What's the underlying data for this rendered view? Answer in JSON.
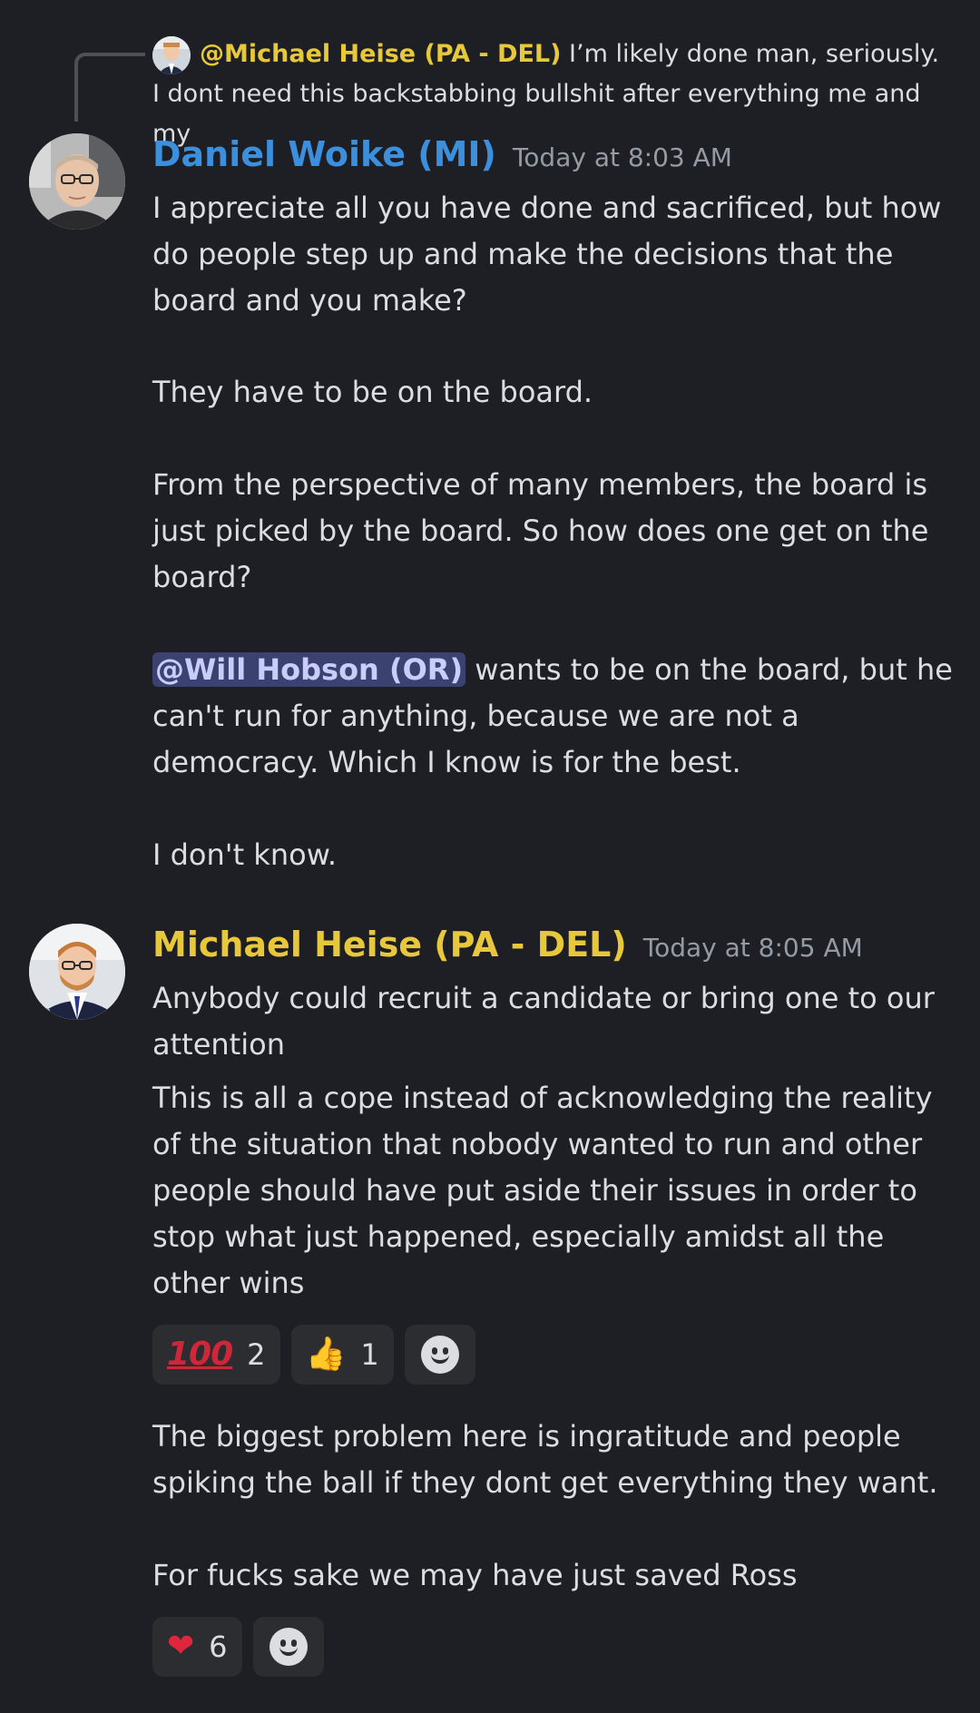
{
  "reply": {
    "author": "@Michael Heise (PA - DEL)",
    "text": "I’m likely done man, seriously. I dont need this backstabbing bullshit after everything me and my"
  },
  "messages": [
    {
      "author": "Daniel Woike (MI)",
      "author_color": "#3b8fdc",
      "timestamp": "Today at 8:03 AM",
      "paragraphs": [
        "I appreciate all you have done and sacrificed, but how do people step up and make the decisions that the board and you make?",
        "They have to be on the board.",
        "From the perspective of many members, the board is just picked by the board. So how does one get on the board?",
        "wants to be on the board, but he can't run for anything, because we are not a democracy. Which I know is for the best.",
        "I don't know."
      ],
      "mention": "@Will Hobson (OR)"
    },
    {
      "author": "Michael Heise (PA - DEL)",
      "author_color": "#e6c83a",
      "timestamp": "Today at 8:05 AM",
      "paragraphs": [
        "Anybody could recruit a candidate or bring one to our attention",
        "This is all a cope instead of acknowledging the reality of the situation that nobody wanted to run and other people should have put aside their issues in order to stop what just happened, especially amidst all the other wins"
      ],
      "reactions": [
        {
          "emoji": "100",
          "count": "2"
        },
        {
          "emoji": "👍",
          "count": "1"
        }
      ],
      "followups": [
        "The biggest problem here is ingratitude and people spiking the ball if they dont get everything they want.",
        "For fucks sake we may have just saved Ross"
      ],
      "followup_reactions": [
        {
          "emoji": "❤",
          "count": "6"
        }
      ]
    }
  ],
  "colors": {
    "background": "#1e1f24",
    "mention_bg": "#3c4270",
    "reaction_bg": "#2b2d31"
  }
}
